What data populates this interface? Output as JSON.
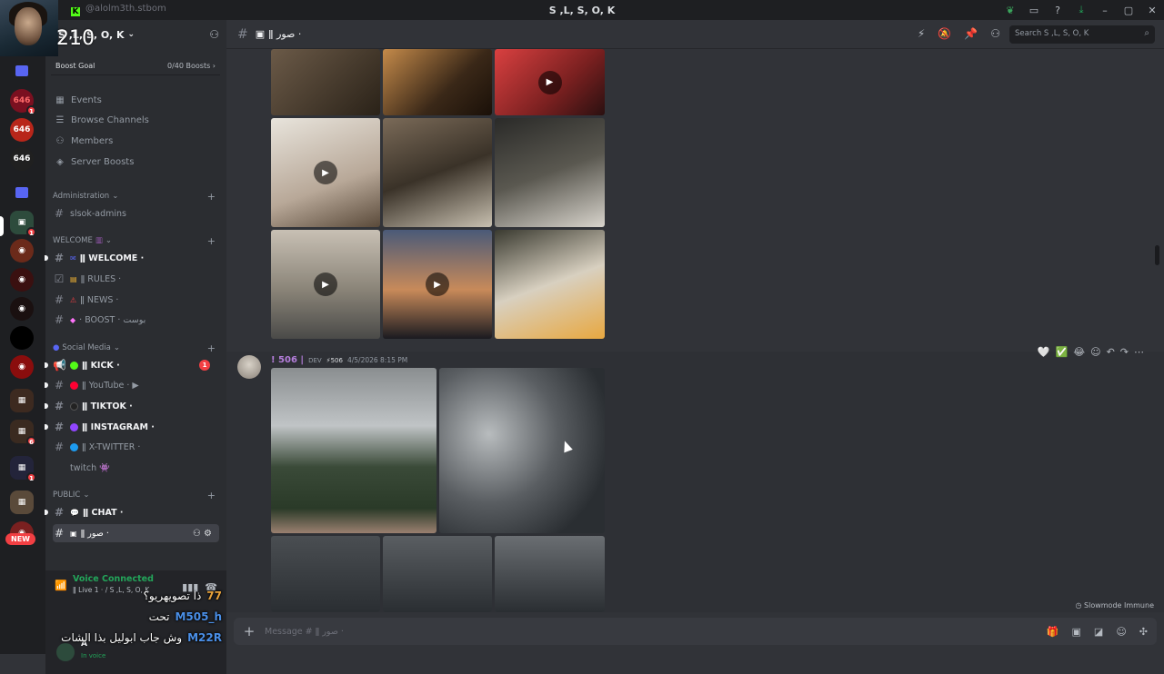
{
  "app": {
    "window_title": "S ,L, S, O, K",
    "corner_overlay": "210",
    "kick_name": "@alolm3th.stbom"
  },
  "server": {
    "name": "S ,L, S, O, K",
    "boost_goal_label": "Boost Goal",
    "boost_goal_value": "0/40 Boosts"
  },
  "nav": [
    {
      "label": "Events",
      "icon": "calendar-icon"
    },
    {
      "label": "Browse Channels",
      "icon": "browse-icon"
    },
    {
      "label": "Members",
      "icon": "members-icon"
    },
    {
      "label": "Server Boosts",
      "icon": "boost-icon"
    }
  ],
  "categories": {
    "administration": "Administration",
    "welcome": "WELCOME",
    "social": "Social Media",
    "public": "PUBLIC"
  },
  "channels": {
    "admin": "slsok-admins",
    "welcome": "ǁ WELCOME ·",
    "rules": "ǁ RULES ·",
    "news": "ǁ NEWS ·",
    "boost": "· BOOST · بوست",
    "kick": "ǁ KICK ·",
    "youtube": "ǁ YouTube · ▶",
    "tiktok": "ǁ TIKTOK ·",
    "instagram": "ǁ INSTAGRAM ·",
    "xtwitter": "ǁ X-TWITTER ·",
    "twitch": "twitch",
    "chat": "ǁ CHAT ·",
    "images": "ǁ صور ·",
    "kick_unread": "1"
  },
  "voice": {
    "status": "Voice Connected",
    "channel": "ǁ Live 1 · / S ,L, S, O, K"
  },
  "user": {
    "name": "A",
    "status": "In voice"
  },
  "overlay_chat": [
    {
      "user": "77",
      "text": "ذا تصويهريو؟"
    },
    {
      "user": "M505_h",
      "text": "تحت"
    },
    {
      "user": "M22R",
      "text": "وش جاب ابوليل بذا الشات"
    }
  ],
  "channel_header": {
    "name": "ǁ صور ·",
    "search_placeholder": "Search S ,L, S, O, K"
  },
  "message": {
    "author": "! 506 |",
    "tag": "DEV",
    "badge": "506",
    "timestamp": "4/5/2026 8:15 PM"
  },
  "composer": {
    "placeholder": "Message # ǁ صور ·"
  },
  "footer_note": "Slowmode Immune",
  "guild_badges": [
    "1",
    "6",
    "1",
    "1"
  ],
  "colors": {
    "accent": "#5865f2",
    "green": "#23a55a",
    "red": "#f23f43",
    "bg": "#313338"
  }
}
